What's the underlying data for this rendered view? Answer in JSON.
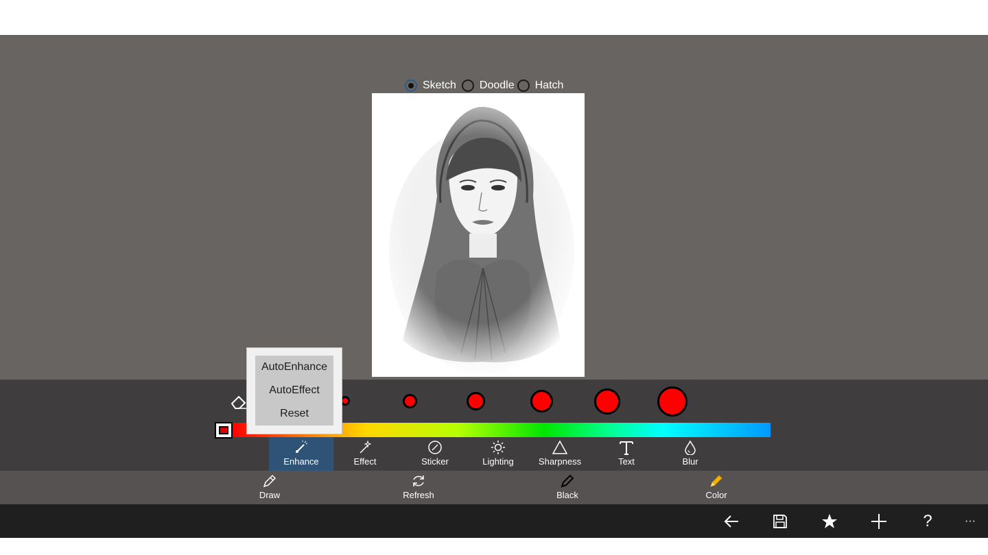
{
  "modes": {
    "items": [
      {
        "label": "Sketch",
        "selected": true
      },
      {
        "label": "Doodle",
        "selected": false
      },
      {
        "label": "Hatch",
        "selected": false
      }
    ]
  },
  "photo": {
    "content": "pencil-sketch-portrait"
  },
  "brush": {
    "eraser_icon": "eraser-icon",
    "selected_color": "#ff0000",
    "gradient_colors": [
      "#ff0000",
      "#ffd800",
      "#00e600",
      "#00ffff",
      "#0099ff"
    ]
  },
  "tools": [
    {
      "label": "Enhance",
      "icon": "brush-icon",
      "active": true
    },
    {
      "label": "Effect",
      "icon": "magic-wand-icon",
      "active": false
    },
    {
      "label": "Sticker",
      "icon": "sticker-icon",
      "active": false
    },
    {
      "label": "Lighting",
      "icon": "sun-icon",
      "active": false
    },
    {
      "label": "Sharpness",
      "icon": "triangle-icon",
      "active": false
    },
    {
      "label": "Text",
      "icon": "text-icon",
      "active": false
    },
    {
      "label": "Blur",
      "icon": "drop-icon",
      "active": false
    }
  ],
  "bottom_tools": [
    {
      "label": "Draw",
      "icon": "draw-icon"
    },
    {
      "label": "Refresh",
      "icon": "refresh-icon"
    },
    {
      "label": "Black",
      "icon": "pen-icon"
    },
    {
      "label": "Color",
      "icon": "pencil-icon"
    }
  ],
  "popup": {
    "items": [
      "AutoEnhance",
      "AutoEffect",
      "Reset"
    ]
  },
  "appbar": {
    "icons": [
      "back-arrow-icon",
      "save-icon",
      "star-icon",
      "add-icon",
      "help-icon",
      "more-icon"
    ],
    "help_glyph": "?",
    "more_glyph": "···"
  }
}
